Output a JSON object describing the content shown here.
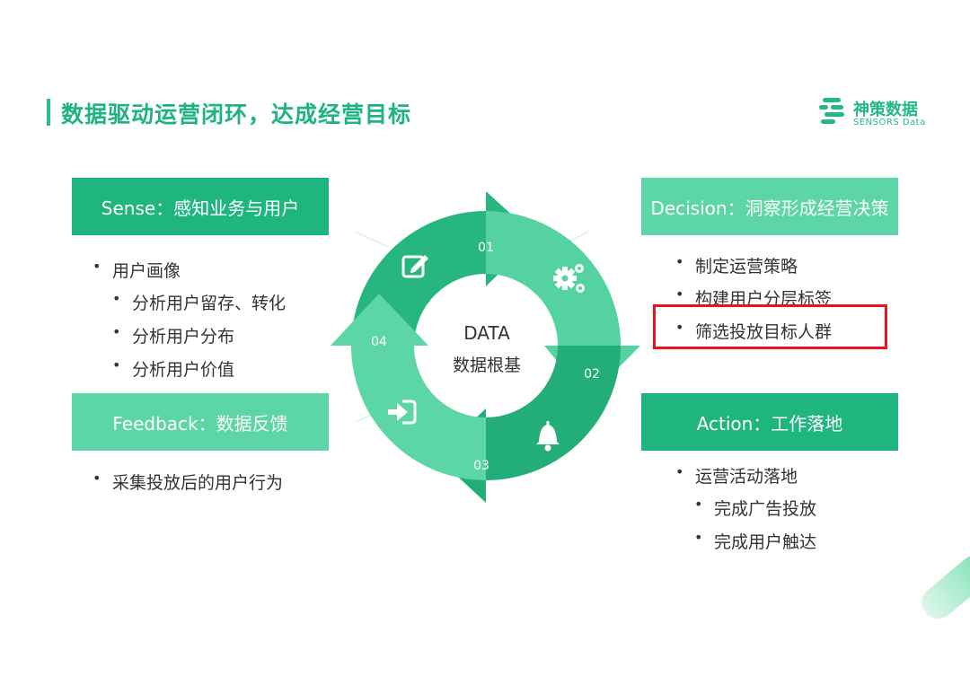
{
  "slide": {
    "title": "数据驱动运营闭环，达成经营目标",
    "logo_cn": "神策数据",
    "logo_en": "SENSORS Data"
  },
  "sense": {
    "header": "Sense：感知业务与用户",
    "items": [
      "用户画像",
      "分析用户留存、转化",
      "分析用户分布",
      "分析用户价值"
    ]
  },
  "decision": {
    "header": "Decision：洞察形成经营决策",
    "items": [
      "制定运营策略",
      "构建用户分层标签",
      "筛选投放目标人群"
    ]
  },
  "feedback": {
    "header": "Feedback：数据反馈",
    "items": [
      "采集投放后的用户行为"
    ]
  },
  "action": {
    "header": "Action：工作落地",
    "items": [
      "运营活动落地",
      "完成广告投放",
      "完成用户触达"
    ]
  },
  "cycle": {
    "center_title": "DATA",
    "center_subtitle": "数据根基",
    "steps": [
      {
        "label": "01",
        "icon": "edit-icon"
      },
      {
        "label": "02",
        "icon": "gears-icon"
      },
      {
        "label": "03",
        "icon": "bell-icon"
      },
      {
        "label": "04",
        "icon": "sign-in-icon"
      }
    ]
  },
  "colors": {
    "accent": "#1fb57f",
    "accent_light": "#5cd6a6",
    "highlight": "#e8131c"
  },
  "bullet_symbol": "•"
}
